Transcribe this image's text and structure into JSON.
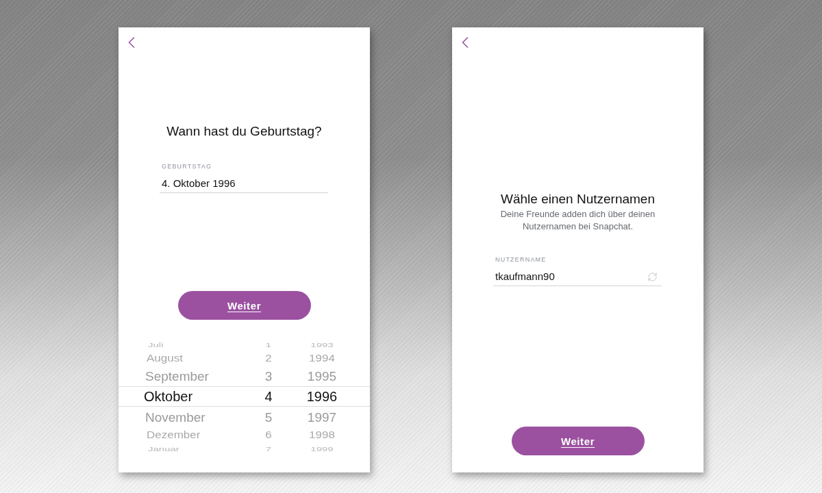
{
  "screens": [
    {
      "title": "Wann hast du Geburtstag?",
      "field": {
        "label": "GEBURTSTAG",
        "value": "4. Oktober 1996",
        "kind": "plain"
      },
      "button": "Weiter",
      "picker": {
        "columns": [
          {
            "items": [
              {
                "text": "Juli",
                "selected": false
              },
              {
                "text": "August",
                "selected": false
              },
              {
                "text": "September",
                "selected": false
              },
              {
                "text": "Oktober",
                "selected": true
              },
              {
                "text": "November",
                "selected": false
              },
              {
                "text": "Dezember",
                "selected": false
              },
              {
                "text": "Januar",
                "selected": false
              }
            ]
          },
          {
            "items": [
              {
                "text": "1",
                "selected": false
              },
              {
                "text": "2",
                "selected": false
              },
              {
                "text": "3",
                "selected": false
              },
              {
                "text": "4",
                "selected": true
              },
              {
                "text": "5",
                "selected": false
              },
              {
                "text": "6",
                "selected": false
              },
              {
                "text": "7",
                "selected": false
              }
            ]
          },
          {
            "items": [
              {
                "text": "1993",
                "selected": false
              },
              {
                "text": "1994",
                "selected": false
              },
              {
                "text": "1995",
                "selected": false
              },
              {
                "text": "1996",
                "selected": true
              },
              {
                "text": "1997",
                "selected": false
              },
              {
                "text": "1998",
                "selected": false
              },
              {
                "text": "1999",
                "selected": false
              }
            ]
          }
        ]
      }
    },
    {
      "title": "Wähle einen Nutzernamen",
      "subtitle": "Deine Freunde adden dich über deinen Nutzernamen bei Snapchat.",
      "field": {
        "label": "NUTZERNAME",
        "value": "tkaufmann90",
        "kind": "refresh"
      },
      "button": "Weiter"
    }
  ]
}
